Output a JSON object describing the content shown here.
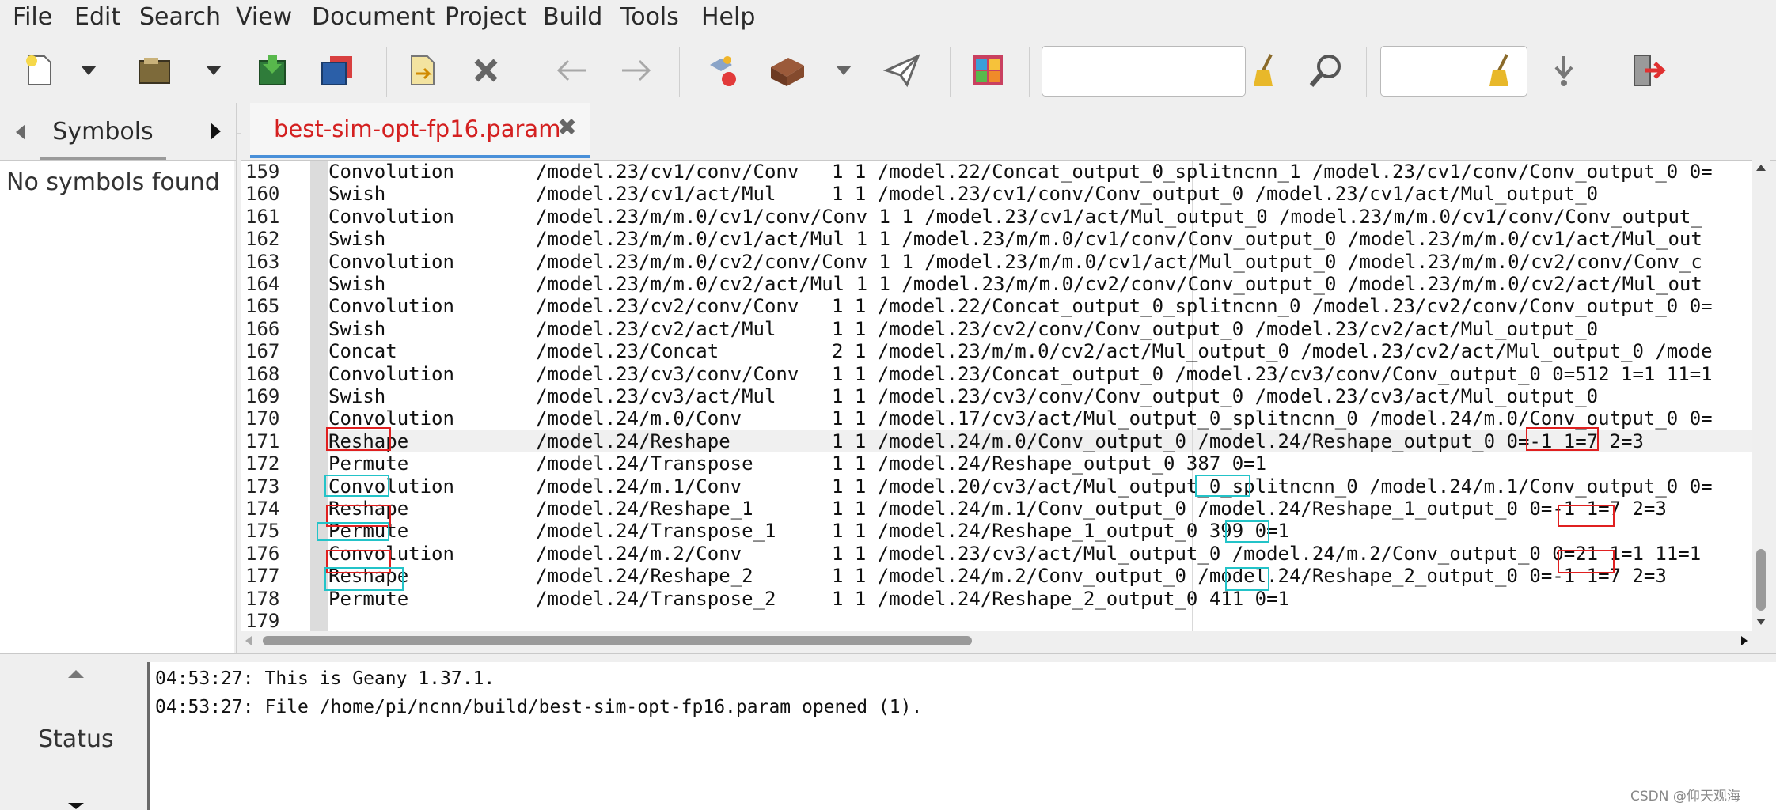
{
  "menu": [
    "File",
    "Edit",
    "Search",
    "View",
    "Document",
    "Project",
    "Build",
    "Tools",
    "Help"
  ],
  "toolbar": {
    "icons": [
      "new-file-icon",
      "dropdown-icon",
      "open-file-icon",
      "dropdown-icon",
      "save-icon",
      "save-all-icon",
      "revert-icon",
      "close-icon",
      "back-icon",
      "forward-icon",
      "compile-icon",
      "build-icon",
      "dropdown-icon",
      "execute-icon",
      "color-chooser-icon",
      "clear-icon",
      "find-icon",
      "clear-icon",
      "jump-to-line-icon",
      "quit-icon"
    ],
    "search_value": "",
    "goto_value": ""
  },
  "sidebar": {
    "tab_label": "Symbols",
    "empty_text": "No symbols found"
  },
  "editor": {
    "tab_label": "best-sim-opt-fp16.param",
    "tab_close": "✖",
    "lines": [
      {
        "n": "159",
        "a": "Convolution",
        "b": "/model.23/cv1/conv/Conv",
        "c": "1 1 /model.22/Concat_output_0_splitncnn_1 /model.23/cv1/conv/Conv_output_0 0="
      },
      {
        "n": "160",
        "a": "Swish",
        "b": "/model.23/cv1/act/Mul",
        "c": "1 1 /model.23/cv1/conv/Conv_output_0 /model.23/cv1/act/Mul_output_0"
      },
      {
        "n": "161",
        "a": "Convolution",
        "b": "/model.23/m/m.0/cv1/conv/Conv 1 1 /model.23/cv1/act/Mul_output_0 /model.23/m/m.0/cv1/conv/Conv_output_",
        "c": ""
      },
      {
        "n": "162",
        "a": "Swish",
        "b": "/model.23/m/m.0/cv1/act/Mul 1 1 /model.23/m/m.0/cv1/conv/Conv_output_0 /model.23/m/m.0/cv1/act/Mul_out",
        "c": ""
      },
      {
        "n": "163",
        "a": "Convolution",
        "b": "/model.23/m/m.0/cv2/conv/Conv 1 1 /model.23/m/m.0/cv1/act/Mul_output_0 /model.23/m/m.0/cv2/conv/Conv_c",
        "c": ""
      },
      {
        "n": "164",
        "a": "Swish",
        "b": "/model.23/m/m.0/cv2/act/Mul 1 1 /model.23/m/m.0/cv2/conv/Conv_output_0 /model.23/m/m.0/cv2/act/Mul_out",
        "c": ""
      },
      {
        "n": "165",
        "a": "Convolution",
        "b": "/model.23/cv2/conv/Conv",
        "c": "1 1 /model.22/Concat_output_0_splitncnn_0 /model.23/cv2/conv/Conv_output_0 0="
      },
      {
        "n": "166",
        "a": "Swish",
        "b": "/model.23/cv2/act/Mul",
        "c": "1 1 /model.23/cv2/conv/Conv_output_0 /model.23/cv2/act/Mul_output_0"
      },
      {
        "n": "167",
        "a": "Concat",
        "b": "/model.23/Concat",
        "c": "2 1 /model.23/m/m.0/cv2/act/Mul_output_0 /model.23/cv2/act/Mul_output_0 /mode"
      },
      {
        "n": "168",
        "a": "Convolution",
        "b": "/model.23/cv3/conv/Conv",
        "c": "1 1 /model.23/Concat_output_0 /model.23/cv3/conv/Conv_output_0 0=512 1=1 11=1"
      },
      {
        "n": "169",
        "a": "Swish",
        "b": "/model.23/cv3/act/Mul",
        "c": "1 1 /model.23/cv3/conv/Conv_output_0 /model.23/cv3/act/Mul_output_0"
      },
      {
        "n": "170",
        "a": "Convolution",
        "b": "/model.24/m.0/Conv",
        "c": "1 1 /model.17/cv3/act/Mul_output_0_splitncnn_0 /model.24/m.0/Conv_output_0 0="
      },
      {
        "n": "171",
        "a": "Reshape",
        "b": "/model.24/Reshape",
        "c": "1 1 /model.24/m.0/Conv_output_0 /model.24/Reshape_output_0 0=-1 1=7 2=3"
      },
      {
        "n": "172",
        "a": "Permute",
        "b": "/model.24/Transpose",
        "c": "1 1 /model.24/Reshape_output_0 387 0=1"
      },
      {
        "n": "173",
        "a": "Convolution",
        "b": "/model.24/m.1/Conv",
        "c": "1 1 /model.20/cv3/act/Mul_output_0_splitncnn_0 /model.24/m.1/Conv_output_0 0="
      },
      {
        "n": "174",
        "a": "Reshape",
        "b": "/model.24/Reshape_1",
        "c": "1 1 /model.24/m.1/Conv_output_0 /model.24/Reshape_1_output_0 0=-1 1=7 2=3"
      },
      {
        "n": "175",
        "a": "Permute",
        "b": "/model.24/Transpose_1",
        "c": "1 1 /model.24/Reshape_1_output_0 399 0=1"
      },
      {
        "n": "176",
        "a": "Convolution",
        "b": "/model.24/m.2/Conv",
        "c": "1 1 /model.23/cv3/act/Mul_output_0 /model.24/m.2/Conv_output_0 0=21 1=1 11=1"
      },
      {
        "n": "177",
        "a": "Reshape",
        "b": "/model.24/Reshape_2",
        "c": "1 1 /model.24/m.2/Conv_output_0 /model.24/Reshape_2_output_0 0=-1 1=7 2=3"
      },
      {
        "n": "178",
        "a": "Permute",
        "b": "/model.24/Transpose_2",
        "c": "1 1 /model.24/Reshape_2_output_0 411 0=1"
      },
      {
        "n": "179",
        "a": "",
        "b": "",
        "c": ""
      }
    ]
  },
  "messages": {
    "tab_label": "Status",
    "lines": [
      "04:53:27: This is Geany 1.37.1.",
      "04:53:27: File /home/pi/ncnn/build/best-sim-opt-fp16.param opened (1)."
    ]
  },
  "watermark": "CSDN @仰天观海"
}
